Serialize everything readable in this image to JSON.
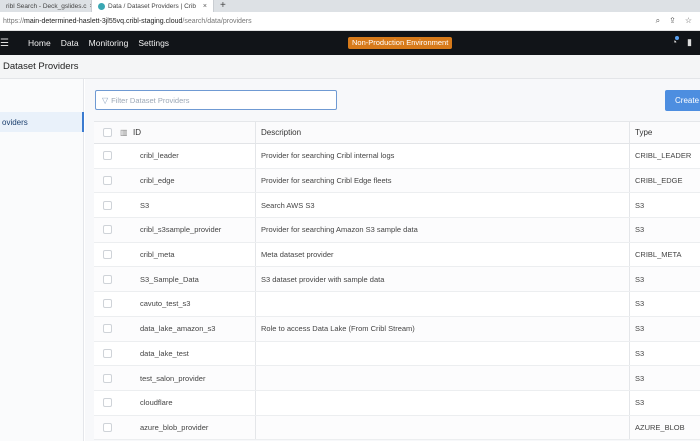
{
  "browser": {
    "tabs": [
      {
        "label": "ribl Search - Deck_gslides.c"
      },
      {
        "label": "Data / Dataset Providers | Crib"
      }
    ],
    "new_tab": "+",
    "url_prefix": "https://",
    "url_host": "main-determined-haslett-3jl55vq.cribl-staging.cloud",
    "url_path": "/search/data/providers"
  },
  "nav": {
    "items": [
      "Home",
      "Data",
      "Monitoring",
      "Settings"
    ],
    "environment_badge": "Non-Production Environment"
  },
  "page": {
    "title": "Dataset Providers"
  },
  "sidebar": {
    "active_item": "oviders"
  },
  "toolbar": {
    "filter_placeholder": "Filter Dataset Providers",
    "create_label": "Create"
  },
  "table": {
    "columns": {
      "id": "ID",
      "description": "Description",
      "type": "Type"
    },
    "rows": [
      {
        "id": "cribl_leader",
        "description": "Provider for searching Cribl internal logs",
        "type": "CRIBL_LEADER"
      },
      {
        "id": "cribl_edge",
        "description": "Provider for searching Cribl Edge fleets",
        "type": "CRIBL_EDGE"
      },
      {
        "id": "S3",
        "description": "Search AWS S3",
        "type": "S3"
      },
      {
        "id": "cribl_s3sample_provider",
        "description": "Provider for searching Amazon S3 sample data",
        "type": "S3"
      },
      {
        "id": "cribl_meta",
        "description": "Meta dataset provider",
        "type": "CRIBL_META"
      },
      {
        "id": "S3_Sample_Data",
        "description": "S3 dataset provider with sample data",
        "type": "S3"
      },
      {
        "id": "cavuto_test_s3",
        "description": "",
        "type": "S3"
      },
      {
        "id": "data_lake_amazon_s3",
        "description": "Role to access Data Lake (From Cribl Stream)",
        "type": "S3"
      },
      {
        "id": "data_lake_test",
        "description": "",
        "type": "S3"
      },
      {
        "id": "test_salon_provider",
        "description": "",
        "type": "S3"
      },
      {
        "id": "cloudflare",
        "description": "",
        "type": "S3"
      },
      {
        "id": "azure_blob_provider",
        "description": "",
        "type": "AZURE_BLOB"
      }
    ]
  },
  "colors": {
    "nav_bg": "#111418",
    "env_badge": "#d77a1a",
    "accent": "#4d8ee0"
  }
}
